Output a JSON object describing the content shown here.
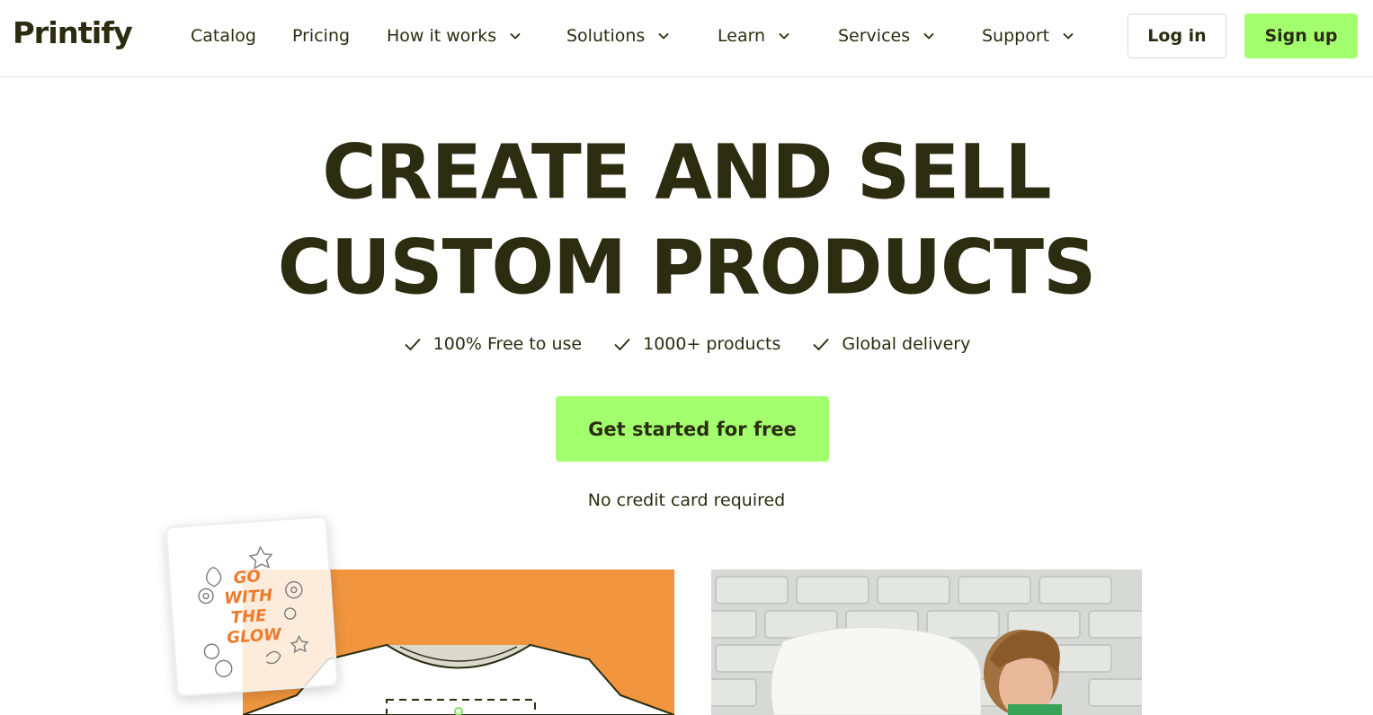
{
  "brand": {
    "name": "Printify"
  },
  "nav": {
    "items": [
      {
        "label": "Catalog",
        "dropdown": false
      },
      {
        "label": "Pricing",
        "dropdown": false
      },
      {
        "label": "How it works",
        "dropdown": true
      },
      {
        "label": "Solutions",
        "dropdown": true
      },
      {
        "label": "Learn",
        "dropdown": true
      },
      {
        "label": "Services",
        "dropdown": true
      },
      {
        "label": "Support",
        "dropdown": true
      }
    ],
    "login_label": "Log in",
    "signup_label": "Sign up"
  },
  "hero": {
    "headline_line1": "CREATE AND SELL",
    "headline_line2": "CUSTOM PRODUCTS",
    "features": [
      "100% Free to use",
      "1000+ products",
      "Global delivery"
    ],
    "cta_label": "Get started for free",
    "cta_note": "No credit card required"
  },
  "sticker": {
    "text": [
      "GO",
      "WITH",
      "THE",
      "GLOW"
    ]
  },
  "colors": {
    "text": "#2b2c10",
    "accent_green": "#a4ff6e",
    "orange": "#f1963f",
    "sticker_text": "#f07a2a"
  },
  "icons": {
    "check": "check-icon",
    "dropdown": "chevron-down-icon"
  }
}
